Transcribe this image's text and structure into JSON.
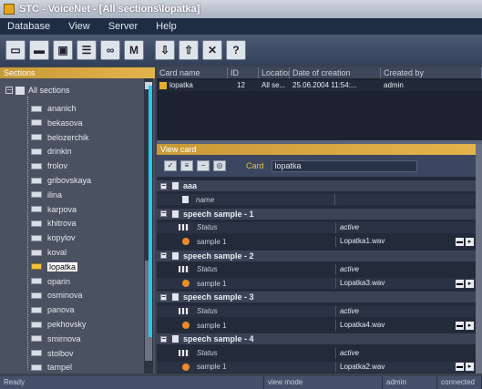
{
  "window": {
    "title": "STC - VoiceNet - [All sections\\lopatka]"
  },
  "menu": [
    "Database",
    "View",
    "Server",
    "Help"
  ],
  "toolbar": {
    "help_label": "?",
    "binoculars_label": "M"
  },
  "left_panel": {
    "header": "Sections",
    "root": "All sections",
    "items": [
      "ananich",
      "bekasova",
      "belozerchik",
      "drinkin",
      "frolov",
      "gribovskaya",
      "ilina",
      "karpova",
      "khitrova",
      "kopylov",
      "koval",
      "lopatka",
      "oparin",
      "osminova",
      "panova",
      "pekhovsky",
      "smirnova",
      "stolbov",
      "tampel"
    ],
    "selected": "lopatka"
  },
  "grid": {
    "columns": [
      "Card name",
      "ID",
      "Location",
      "Date of creation",
      "Created by"
    ],
    "rows": [
      {
        "card_name": "lopatka",
        "id": "12",
        "location": "All se...",
        "date": "25.06.2004 11:54:...",
        "created_by": "admin"
      }
    ]
  },
  "view_card": {
    "header": "View card",
    "card_label": "Card",
    "card_value": "lopatka",
    "rows": [
      {
        "type": "group",
        "label": "aaa"
      },
      {
        "type": "field",
        "label": "name",
        "value": ""
      },
      {
        "type": "group",
        "label": "speech sample - 1"
      },
      {
        "type": "status",
        "label": "Status",
        "value": "active"
      },
      {
        "type": "sample",
        "label": "sample 1",
        "value": "Lopatka1.wav"
      },
      {
        "type": "group",
        "label": "speech sample - 2"
      },
      {
        "type": "status",
        "label": "Status",
        "value": "active"
      },
      {
        "type": "sample",
        "label": "sample 1",
        "value": "Lopatka3.wav"
      },
      {
        "type": "group",
        "label": "speech sample - 3"
      },
      {
        "type": "status",
        "label": "Status",
        "value": "active"
      },
      {
        "type": "sample",
        "label": "sample 1",
        "value": "Lopatka4.wav"
      },
      {
        "type": "group",
        "label": "speech sample - 4"
      },
      {
        "type": "status",
        "label": "Status",
        "value": "active"
      },
      {
        "type": "sample",
        "label": "sample 1",
        "value": "Lopatka2.wav"
      }
    ]
  },
  "statusbar": {
    "ready": "Ready",
    "mode": "view mode",
    "user": "admin",
    "connection": "connected"
  },
  "colors": {
    "accent_header": "#d4a640",
    "highlight": "#27c7ee",
    "background": "#3c4350"
  }
}
